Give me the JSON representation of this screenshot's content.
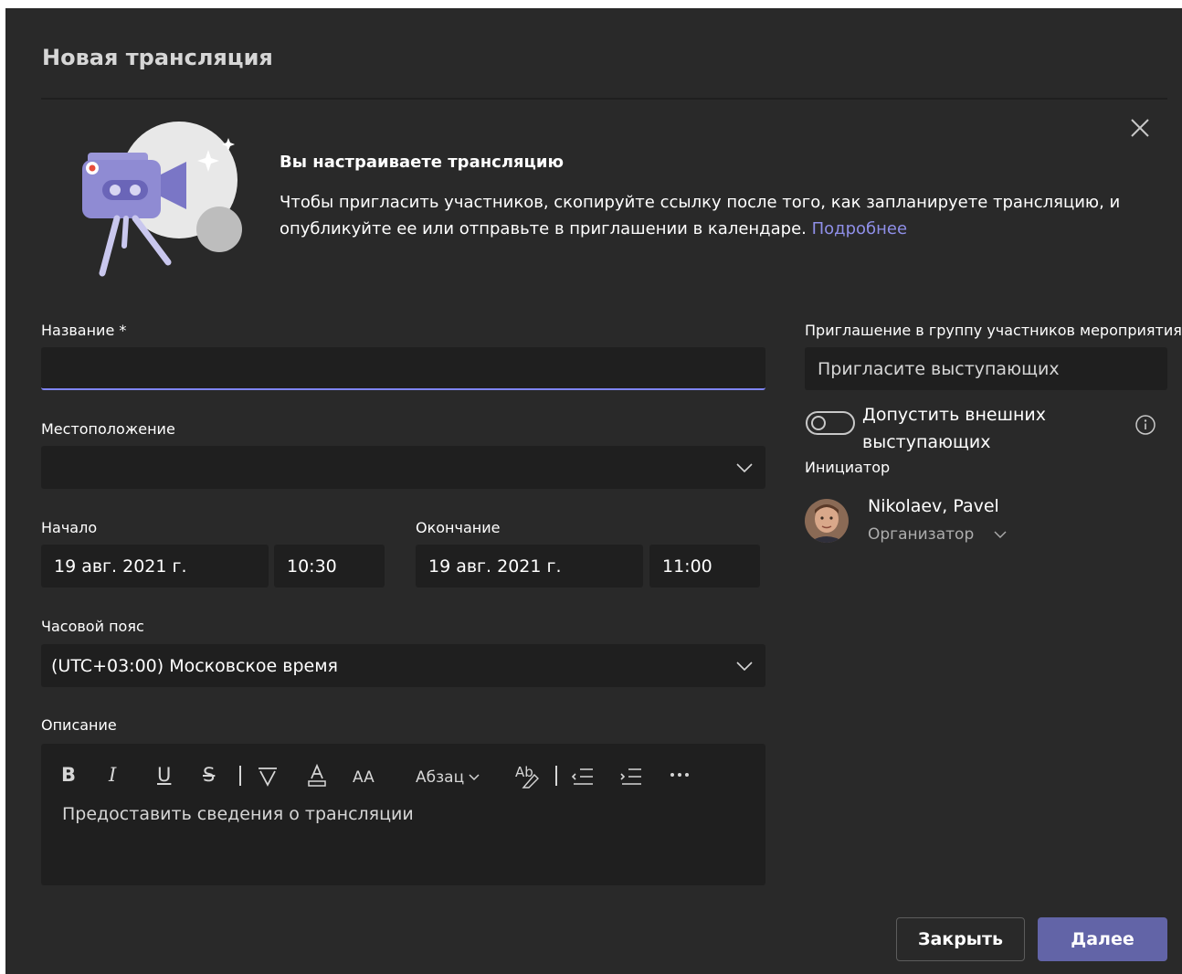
{
  "dialog": {
    "title": "Новая трансляция"
  },
  "banner": {
    "title": "Вы настраиваете трансляцию",
    "text": "Чтобы пригласить участников, скопируйте ссылку после того, как запланируете трансляцию, и опубликуйте ее или отправьте в приглашении в календаре.",
    "link": "Подробнее"
  },
  "form": {
    "name_label": "Название *",
    "name_value": "",
    "location_label": "Местоположение",
    "location_value": "",
    "start_label": "Начало",
    "start_date": "19 авг. 2021 г.",
    "start_time": "10:30",
    "end_label": "Окончание",
    "end_date": "19 авг. 2021 г.",
    "end_time": "11:00",
    "timezone_label": "Часовой пояс",
    "timezone_value": "(UTC+03:00) Московское время",
    "description_label": "Описание",
    "description_placeholder": "Предоставить сведения о трансляции"
  },
  "toolbar": {
    "bold": "B",
    "italic": "I",
    "underline": "U",
    "strike": "S",
    "font_size": "AA",
    "paragraph": "Абзац"
  },
  "invite": {
    "label": "Приглашение в группу участников мероприятия",
    "placeholder": "Пригласите выступающих",
    "toggle_label": "Допустить внешних выступающих",
    "toggle_on": false
  },
  "organizer": {
    "label": "Инициатор",
    "name": "Nikolaev, Pavel",
    "role": "Организатор"
  },
  "buttons": {
    "close": "Закрыть",
    "next": "Далее"
  },
  "colors": {
    "background": "#292929",
    "field": "#1f1f1f",
    "accent": "#6264a7",
    "link": "#8f8fe8",
    "focus_underline": "#7f85f5"
  }
}
